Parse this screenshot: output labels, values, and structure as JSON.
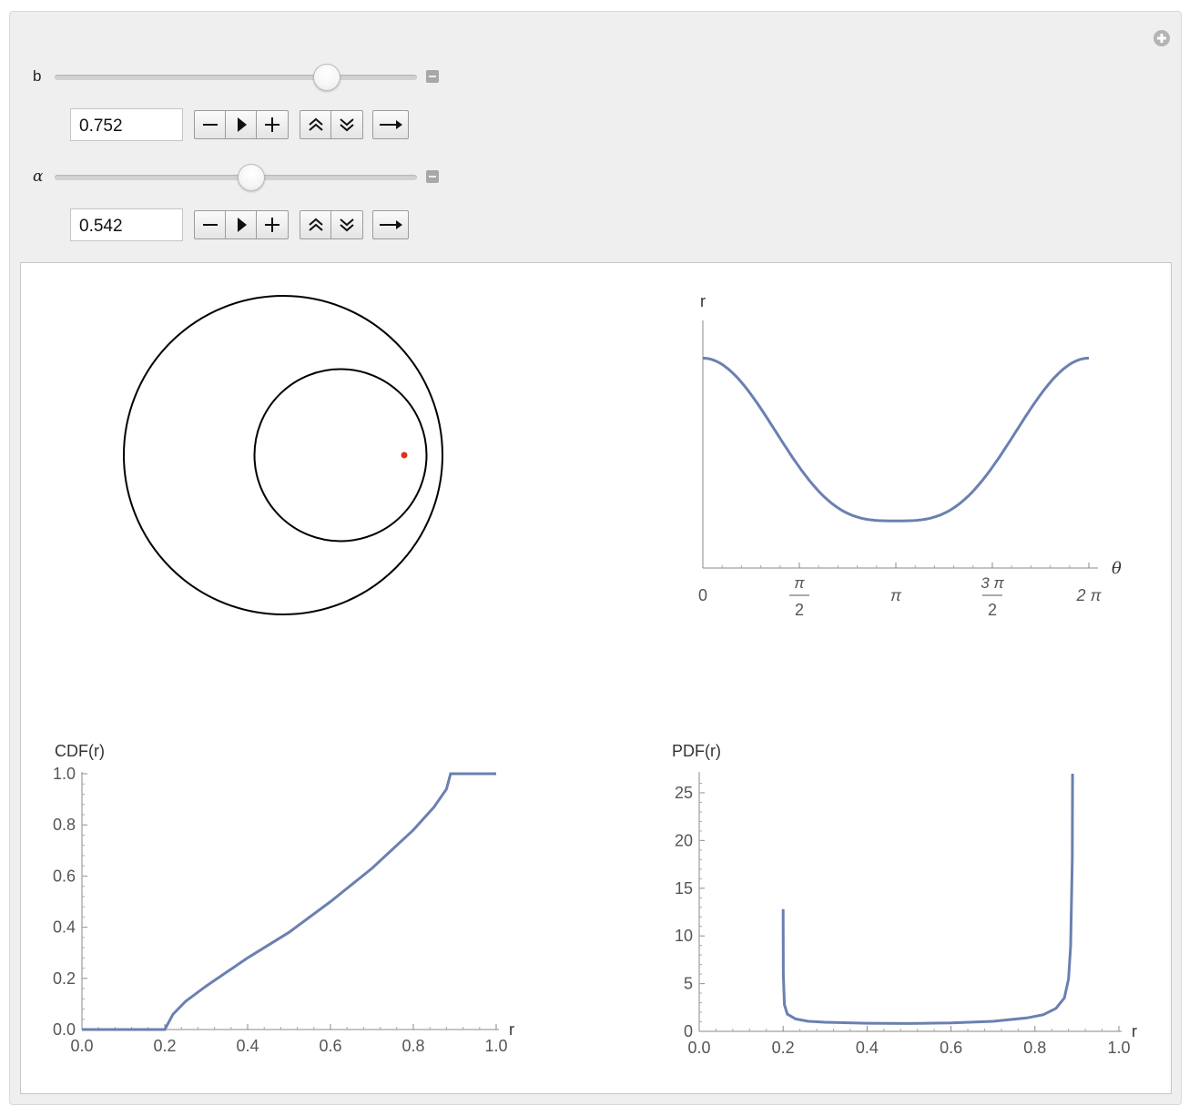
{
  "controls": {
    "b": {
      "label": "b",
      "value": "0.752",
      "fraction": 0.752
    },
    "alpha": {
      "label": "α",
      "value": "0.542",
      "fraction": 0.542
    }
  },
  "buttons": {
    "decrement": "minus-icon",
    "play": "play-icon",
    "increment": "plus-icon",
    "faster": "double-chevron-up-icon",
    "slower": "double-chevron-down-icon",
    "direction": "right-arrow-icon"
  },
  "colors": {
    "curve": "#6a80b0",
    "point": "#e0321e",
    "circle": "#000000",
    "frame_bg": "#efefef"
  },
  "chart_data": [
    {
      "type": "diagram",
      "outer_circle": {
        "cx": 0,
        "cy": 0,
        "r": 1
      },
      "inner_circle": {
        "cx": 0.36,
        "cy": 0,
        "r": 0.54
      },
      "point": {
        "x": 0.76,
        "y": 0
      }
    },
    {
      "type": "line",
      "xlabel": "θ",
      "ylabel": "r",
      "x_ticks": [
        {
          "num": "0",
          "den": ""
        },
        {
          "num": "π",
          "den": "2"
        },
        {
          "num": "π",
          "den": ""
        },
        {
          "num": "3 π",
          "den": "2"
        },
        {
          "num": "2 π",
          "den": ""
        }
      ],
      "xlim": [
        0,
        6.2832
      ],
      "ylim": [
        0,
        1.05
      ],
      "series": [
        {
          "x_fn": "theta",
          "y_shape": "cos-bell",
          "max": 0.89,
          "min": 0.2
        }
      ]
    },
    {
      "type": "line",
      "ylabel": "CDF(r)",
      "xlabel": "r",
      "xlim": [
        0,
        1
      ],
      "ylim": [
        0,
        1
      ],
      "x_ticks": [
        "0.0",
        "0.2",
        "0.4",
        "0.6",
        "0.8",
        "1.0"
      ],
      "y_ticks": [
        "0.0",
        "0.2",
        "0.4",
        "0.6",
        "0.8",
        "1.0"
      ],
      "x": [
        0,
        0.2,
        0.22,
        0.25,
        0.3,
        0.4,
        0.5,
        0.6,
        0.7,
        0.8,
        0.85,
        0.88,
        0.89,
        1.0
      ],
      "y": [
        0,
        0,
        0.06,
        0.11,
        0.17,
        0.28,
        0.38,
        0.5,
        0.63,
        0.78,
        0.87,
        0.94,
        1.0,
        1.0
      ]
    },
    {
      "type": "line",
      "ylabel": "PDF(r)",
      "xlabel": "r",
      "xlim": [
        0,
        1
      ],
      "ylim": [
        0,
        27
      ],
      "x_ticks": [
        "0.0",
        "0.2",
        "0.4",
        "0.6",
        "0.8",
        "1.0"
      ],
      "y_ticks": [
        "0",
        "5",
        "10",
        "15",
        "20",
        "25"
      ],
      "y_tick_values": [
        0,
        5,
        10,
        15,
        20,
        25
      ],
      "x": [
        0.2,
        0.2005,
        0.203,
        0.21,
        0.23,
        0.26,
        0.3,
        0.4,
        0.5,
        0.6,
        0.7,
        0.78,
        0.82,
        0.85,
        0.87,
        0.88,
        0.885,
        0.889,
        0.8895
      ],
      "y": [
        12.8,
        6.0,
        2.8,
        1.8,
        1.3,
        1.05,
        0.95,
        0.85,
        0.82,
        0.88,
        1.05,
        1.4,
        1.75,
        2.4,
        3.5,
        5.5,
        9.0,
        18.0,
        27.0
      ]
    }
  ]
}
